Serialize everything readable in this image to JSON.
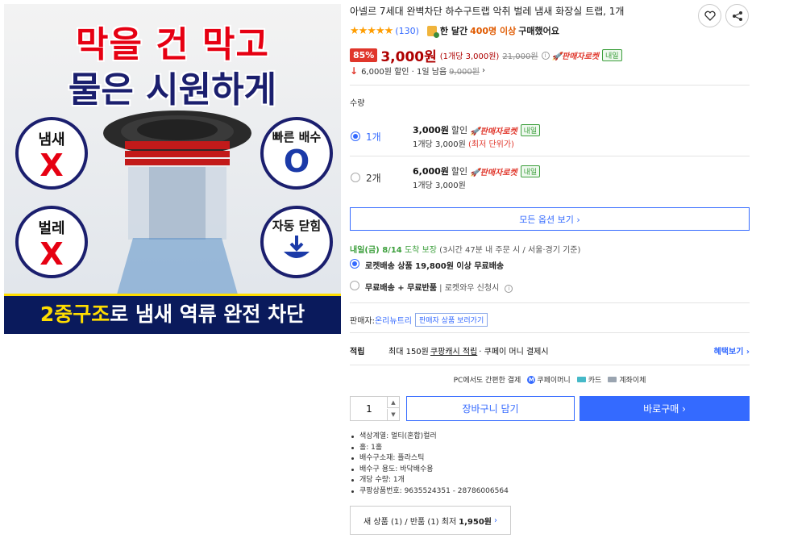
{
  "product_image": {
    "headline_line1": "막을 건 막고",
    "headline_line2": "물은 시원하게",
    "bubble_smell": {
      "label": "냄새",
      "mark": "X"
    },
    "bubble_bugs": {
      "label": "벌레",
      "mark": "X"
    },
    "bubble_drain": {
      "label": "빠른 배수",
      "mark": "O"
    },
    "bubble_auto": {
      "label": "자동 닫힘"
    },
    "bottom_highlight": "2중구조",
    "bottom_rest": "로 냄새 역류 완전 차단"
  },
  "title": "아넬르 7세대 완벽차단 하수구트랩 악취 벌레 냄새 화장실 트랩, 1개",
  "rating": {
    "stars": "★★★★★",
    "review_count": "(130)",
    "purchase_prefix": "한 달간",
    "purchase_count": "400명 이상",
    "purchase_suffix": "구매했어요"
  },
  "price": {
    "discount_rate": "85%",
    "sale_price": "3,000원",
    "unit_price": "(1개당 3,000원)",
    "original_price": "21,000원",
    "rocket_label": "판매자로켓",
    "tomorrow_badge": "내일"
  },
  "discount_info": {
    "arrow": "↓",
    "text": "6,000원 할인 · 1일 남음",
    "strike": "9,000원",
    "chevron": "›"
  },
  "quantity_label": "수량",
  "options": [
    {
      "name": "1개",
      "price": "3,000원",
      "discount_label": "할인",
      "rocket": "판매자로켓",
      "badge": "내일",
      "unit": "1개당 3,000원",
      "lowest": "(최저 단위가)",
      "selected": true
    },
    {
      "name": "2개",
      "price": "6,000원",
      "discount_label": "할인",
      "rocket": "판매자로켓",
      "badge": "내일",
      "unit": "1개당 3,000원",
      "lowest": "",
      "selected": false
    }
  ],
  "all_options_label": "모든 옵션 보기 ›",
  "delivery": {
    "date": "내일(금) 8/14",
    "date_suffix": "도착 보장",
    "detail": "(3시간 47분 내 주문 시 / 서울·경기 기준)",
    "option1_bold": "로켓배송 상품 19,800원 이상 무료배송",
    "option2_bold": "무료배송 + 무료반품",
    "option2_sub": "| 로켓와우 신청시"
  },
  "seller": {
    "label": "판매자:",
    "name": "온리뉴트리",
    "link": "판매자 상품 보러가기"
  },
  "points": {
    "label": "적립",
    "prefix": "최대 150원",
    "underlined": "쿠팡캐시 적립",
    "suffix": "· 쿠페이 머니 결제시",
    "more": "혜택보기 ›"
  },
  "payment": {
    "intro": "PC에서도 간편한 결제",
    "method1": "쿠페이머니",
    "method2": "카드",
    "method3": "계좌이체"
  },
  "purchase": {
    "quantity": "1",
    "cart_label": "장바구니 담기",
    "buy_label": "바로구매 ›"
  },
  "specs": [
    "색상계열: 멀티(혼합)컬러",
    "홀: 1홀",
    "배수구소재: 플라스틱",
    "배수구 용도: 바닥배수용",
    "개당 수량: 1개",
    "쿠팡상품번호: 9635524351 - 28786006564"
  ],
  "new_used": {
    "prefix": "새 상품 (1) / 반품 (1) 최저",
    "price": "1,950원",
    "chevron": "›"
  },
  "colors": {
    "accent": "#346aff",
    "sale": "#ae0000",
    "badge": "#e0362b",
    "green": "#3c9f3c"
  }
}
